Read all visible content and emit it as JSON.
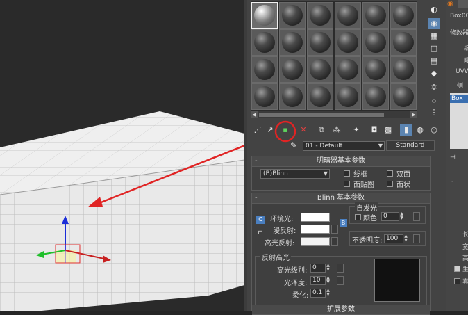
{
  "viewport": {
    "colors": {
      "background": "#2a2a2a",
      "box_face": "#efefef",
      "grid_lines": "#c7c7c7",
      "arrow": "#e02424",
      "highlight_circle": "#e02424"
    }
  },
  "material_editor": {
    "slot_rows": 4,
    "slot_cols": 6,
    "selected_slot": 0,
    "material_name": "01 - Default",
    "material_type": "Standard",
    "shader_rollout": {
      "title": "明暗器基本参数",
      "shader": "(B)Blinn",
      "wire": "线框",
      "two_sided": "双面",
      "face_map": "面贴图",
      "faceted": "面状"
    },
    "blinn_rollout": {
      "title": "Blinn 基本参数",
      "self_illum_group": "自发光",
      "color_label": "颜色",
      "self_illum_value": "0",
      "ambient": "环境光:",
      "diffuse": "漫反射:",
      "specular": "高光反射:",
      "lock_label": "C",
      "diffuse_map_label": "B",
      "opacity_label": "不透明度:",
      "opacity_value": "100",
      "spec_group": "反射高光",
      "spec_level_label": "高光级别:",
      "spec_level_value": "0",
      "glossiness_label": "光泽度:",
      "glossiness_value": "10",
      "soften_label": "柔化:",
      "soften_value": "0.1",
      "next_rollout": "扩展参数"
    }
  },
  "command_panel": {
    "object_name": "Box00",
    "modifier_list": "修改器",
    "uvw": "UVW",
    "item_box": "Box",
    "partial_1": "编",
    "partial_2": "曝",
    "partial_3": "侧",
    "minus": "-",
    "param_1": "长",
    "param_2": "宽",
    "param_3": "高",
    "check_1": "生",
    "check_2": "真"
  }
}
